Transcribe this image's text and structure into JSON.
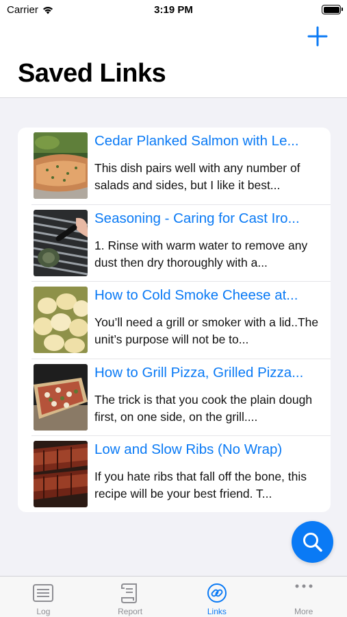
{
  "status_bar": {
    "carrier": "Carrier",
    "time": "3:19 PM"
  },
  "header": {
    "title": "Saved Links",
    "add_icon": "plus-icon"
  },
  "links": [
    {
      "title": "Cedar Planked Salmon with Le...",
      "description": "This dish pairs well with any number of salads and sides, but I like it best...",
      "thumbnail": "salmon-photo"
    },
    {
      "title": "Seasoning - Caring for Cast Iro...",
      "description": "1. Rinse with warm water to remove any dust then dry thoroughly with a...",
      "thumbnail": "grill-grate-photo"
    },
    {
      "title": "How to Cold Smoke Cheese at...",
      "description": "You’ll need a grill or smoker with a lid..The unit’s purpose will not be to...",
      "thumbnail": "cheese-photo"
    },
    {
      "title": "How to Grill Pizza, Grilled Pizza...",
      "description": "The trick is that you cook the plain dough first, on one side, on the grill....",
      "thumbnail": "pizza-photo"
    },
    {
      "title": "Low and Slow Ribs (No Wrap)",
      "description": "If you hate ribs that fall off the bone, this recipe will be your best friend. T...",
      "thumbnail": "ribs-photo"
    }
  ],
  "search_fab": {
    "icon": "search-icon"
  },
  "tabs": [
    {
      "label": "Log",
      "icon": "log-list-icon",
      "active": false
    },
    {
      "label": "Report",
      "icon": "report-scroll-icon",
      "active": false
    },
    {
      "label": "Links",
      "icon": "link-icon",
      "active": true
    },
    {
      "label": "More",
      "icon": "ellipsis-icon",
      "active": false
    }
  ],
  "colors": {
    "accent": "#0a7af5",
    "background": "#f2f2f7",
    "inactive_tab": "#8e8e93"
  }
}
